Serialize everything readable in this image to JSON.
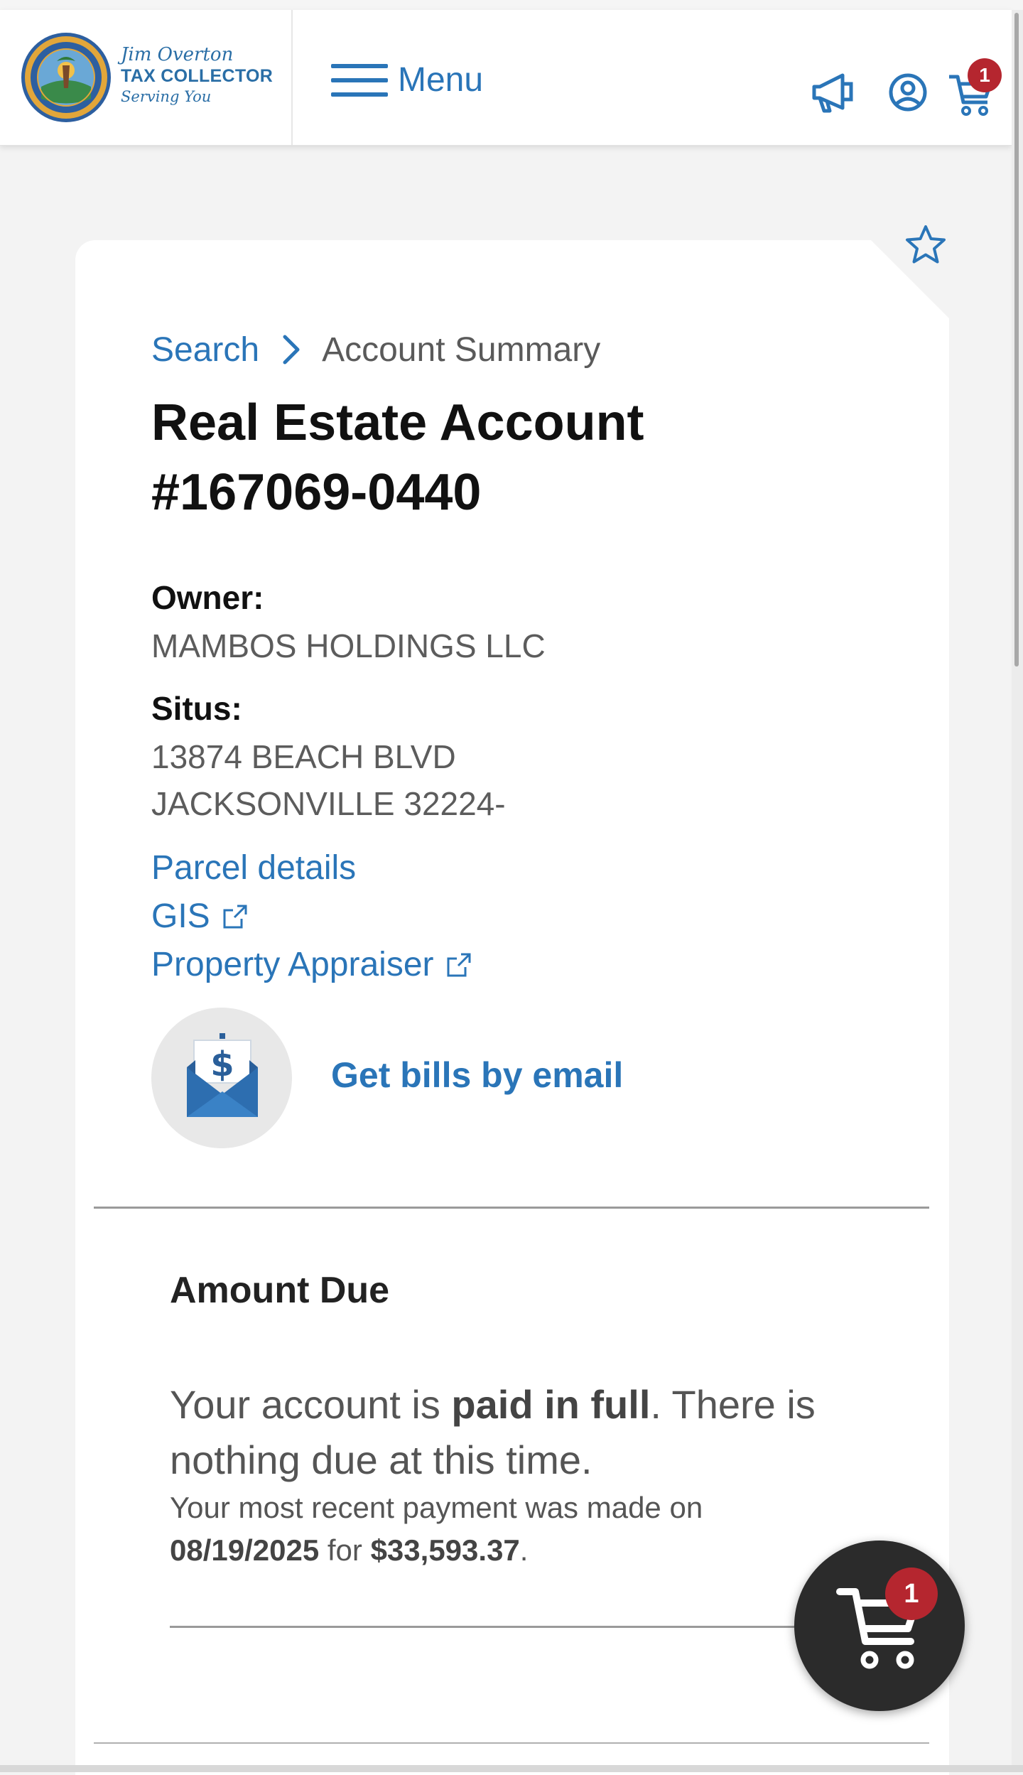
{
  "header": {
    "logo": {
      "name": "Jim Overton",
      "office": "TAX COLLECTOR",
      "tagline": "Serving You",
      "seal_text": "DUVAL COUNTY TAX COLLECTOR"
    },
    "menu_label": "Menu",
    "icons": [
      "megaphone-icon",
      "user-circle-icon",
      "cart-icon"
    ],
    "cart_count": "1"
  },
  "breadcrumb": {
    "search": "Search",
    "current": "Account Summary"
  },
  "account": {
    "title_line1": "Real Estate Account",
    "title_line2": "#167069-0440",
    "owner_label": "Owner:",
    "owner_value": "MAMBOS HOLDINGS LLC",
    "situs_label": "Situs:",
    "situs_line1": "13874 BEACH BLVD",
    "situs_line2": "JACKSONVILLE 32224-"
  },
  "links": {
    "parcel_details": "Parcel details",
    "gis": "GIS",
    "property_appraiser": "Property Appraiser",
    "get_bills_email": "Get bills by email"
  },
  "amount_due": {
    "title": "Amount Due",
    "paid_pre": "Your account is ",
    "paid_bold": "paid in full",
    "paid_post": ". There is nothing due at this time.",
    "recent_pre": "Your most recent payment was made on ",
    "recent_date": "08/19/2025",
    "recent_mid": " for ",
    "recent_amount": "$33,593.37",
    "recent_post": "."
  },
  "floating_cart": {
    "count": "1"
  },
  "colors": {
    "accent_blue": "#2a75b8",
    "badge_red": "#b5262f",
    "fab_dark": "#2b2b2b",
    "page_bg": "#f3f3f3"
  }
}
